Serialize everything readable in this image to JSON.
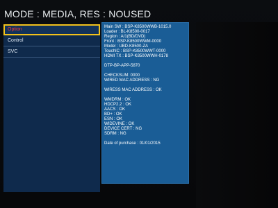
{
  "header": {
    "title": "MODE : MEDIA, RES : NOUSED"
  },
  "menu": {
    "items": [
      {
        "label": "Option",
        "selected": true
      },
      {
        "label": "Control",
        "selected": false
      },
      {
        "label": "SVC",
        "selected": false
      }
    ]
  },
  "info": {
    "block1": [
      "Main SW : BSP-K8500WWB-1015.0",
      "Loader : BL-K8500-0017",
      "Region : A/1(BD/DVD)",
      "Front : BSP-K8500WWM-0000",
      "Model : UBD-K8500-ZA",
      "TouchIC : BSP-K8500WWT-0000",
      "HDMI TX : BSP-K8500WWH-0178"
    ],
    "block2": [
      "DTP-BP-APP-5870"
    ],
    "block3": [
      "CHECKSUM: 0000",
      "WIRED MAC ADDRESS : NG"
    ],
    "block4": [
      "WIRESS MAC ADDRESS : OK"
    ],
    "block5": [
      "WMDRM : OK",
      "HDCP2.2 : OK",
      "AACS : OK",
      "BD+ : OK",
      "ESN : OK",
      "WIDEVINE : OK",
      "DEVICE CERT : NG",
      "SDRM : NG"
    ],
    "block6": [
      "Date of purchase : 01/01/2015"
    ]
  },
  "colors": {
    "selected_text": "#ff3b3b",
    "selected_outline": "#f3c21b",
    "info_panel": "#1a5d96",
    "menu_bg": "#0f2a4c"
  }
}
